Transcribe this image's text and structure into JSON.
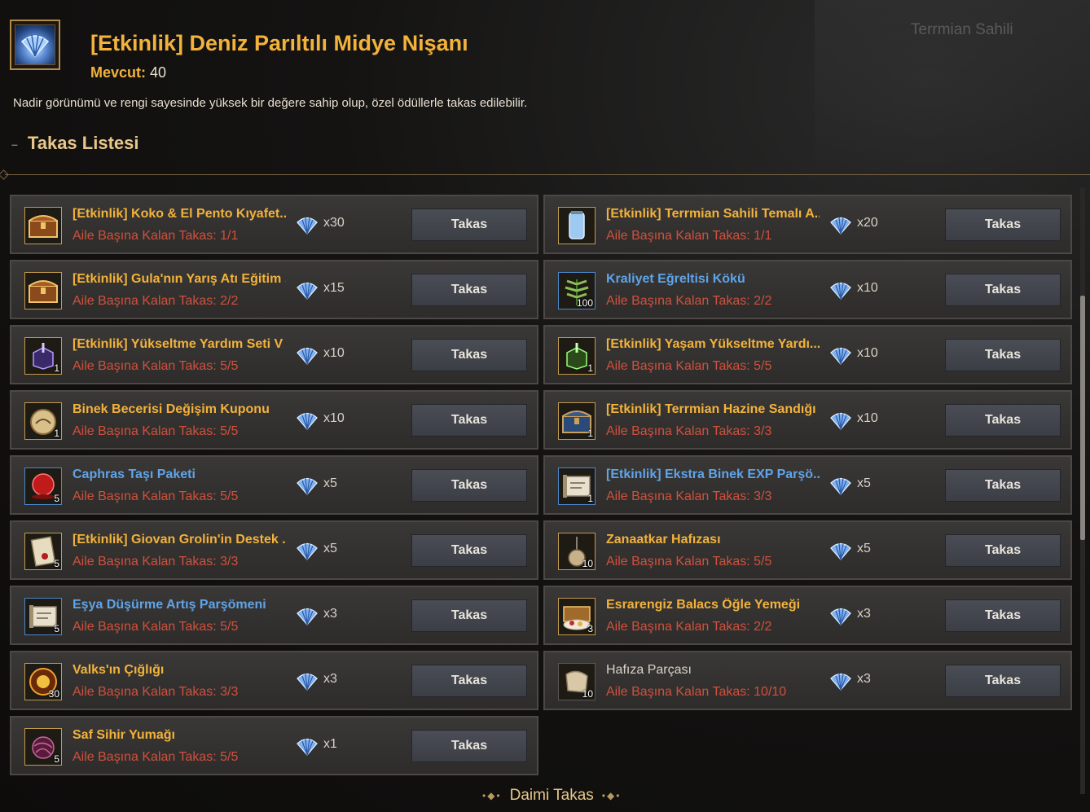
{
  "map": {
    "label": "Terrmian Sahili"
  },
  "header": {
    "title": "[Etkinlik] Deniz Parıltılı Midye Nişanı",
    "mevcut_label": "Mevcut:",
    "mevcut_value": "40",
    "description": "Nadir görünümü ve rengi sayesinde yüksek bir değere sahip olup, özel ödüllerle takas edilebilir."
  },
  "section": {
    "title": "Takas Listesi"
  },
  "colors": {
    "accent": "#f2b23b",
    "remaining": "#d0503c",
    "rare_blue": "#5fa4e8"
  },
  "exchange_button_label": "Takas",
  "items": [
    {
      "name": "[Etkinlik] Koko & El Pento Kıyafet...",
      "name_color": "yellow",
      "icon": "chest-icon",
      "qty": "",
      "remaining_label": "Aile Başına Kalan Takas:",
      "remaining": "1/1",
      "cost": "x30"
    },
    {
      "name": "[Etkinlik] Terrmian Sahili Temalı A...",
      "name_color": "yellow",
      "icon": "jar-icon",
      "qty": "",
      "remaining_label": "Aile Başına Kalan Takas:",
      "remaining": "1/1",
      "cost": "x20"
    },
    {
      "name": "[Etkinlik] Gula'nın Yarış Atı Eğitim ...",
      "name_color": "yellow",
      "icon": "chest-icon",
      "qty": "",
      "remaining_label": "Aile Başına Kalan Takas:",
      "remaining": "2/2",
      "cost": "x15"
    },
    {
      "name": "Kraliyet Eğreltisi Kökü",
      "name_color": "blue",
      "icon": "fern-icon",
      "qty": "100",
      "remaining_label": "Aile Başına Kalan Takas:",
      "remaining": "2/2",
      "cost": "x10"
    },
    {
      "name": "[Etkinlik] Yükseltme Yardım Seti V",
      "name_color": "yellow",
      "icon": "purple-box-icon",
      "qty": "1",
      "remaining_label": "Aile Başına Kalan Takas:",
      "remaining": "5/5",
      "cost": "x10"
    },
    {
      "name": "[Etkinlik] Yaşam Yükseltme Yardı...",
      "name_color": "yellow",
      "icon": "green-box-icon",
      "qty": "1",
      "remaining_label": "Aile Başına Kalan Takas:",
      "remaining": "5/5",
      "cost": "x10"
    },
    {
      "name": "Binek Becerisi Değişim Kuponu",
      "name_color": "yellow",
      "icon": "coupon-icon",
      "qty": "1",
      "remaining_label": "Aile Başına Kalan Takas:",
      "remaining": "5/5",
      "cost": "x10"
    },
    {
      "name": "[Etkinlik] Terrmian Hazine Sandığı",
      "name_color": "yellow",
      "icon": "treasure-chest-icon",
      "qty": "1",
      "remaining_label": "Aile Başına Kalan Takas:",
      "remaining": "3/3",
      "cost": "x10"
    },
    {
      "name": "Caphras Taşı Paketi",
      "name_color": "blue",
      "icon": "red-stone-icon",
      "qty": "5",
      "remaining_label": "Aile Başına Kalan Takas:",
      "remaining": "5/5",
      "cost": "x5"
    },
    {
      "name": "[Etkinlik] Ekstra Binek EXP Parşö...",
      "name_color": "blue",
      "icon": "scroll-icon",
      "qty": "1",
      "remaining_label": "Aile Başına Kalan Takas:",
      "remaining": "3/3",
      "cost": "x5"
    },
    {
      "name": "[Etkinlik] Giovan Grolin'in Destek ...",
      "name_color": "yellow",
      "icon": "letter-icon",
      "qty": "5",
      "remaining_label": "Aile Başına Kalan Takas:",
      "remaining": "3/3",
      "cost": "x5"
    },
    {
      "name": "Zanaatkar Hafızası",
      "name_color": "yellow",
      "icon": "memory-icon",
      "qty": "10",
      "remaining_label": "Aile Başına Kalan Takas:",
      "remaining": "5/5",
      "cost": "x5"
    },
    {
      "name": "Eşya Düşürme Artış Parşömeni",
      "name_color": "blue",
      "icon": "scroll-icon",
      "qty": "5",
      "remaining_label": "Aile Başına Kalan Takas:",
      "remaining": "5/5",
      "cost": "x3"
    },
    {
      "name": "Esrarengiz Balacs Öğle Yemeği",
      "name_color": "yellow",
      "icon": "food-icon",
      "qty": "3",
      "remaining_label": "Aile Başına Kalan Takas:",
      "remaining": "2/2",
      "cost": "x3"
    },
    {
      "name": "Valks'ın Çığlığı",
      "name_color": "yellow",
      "icon": "orb-icon",
      "qty": "30",
      "remaining_label": "Aile Başına Kalan Takas:",
      "remaining": "3/3",
      "cost": "x3"
    },
    {
      "name": "Hafıza Parçası",
      "name_color": "white",
      "icon": "fragment-icon",
      "qty": "10",
      "remaining_label": "Aile Başına Kalan Takas:",
      "remaining": "10/10",
      "cost": "x3"
    },
    {
      "name": "Saf Sihir Yumağı",
      "name_color": "yellow",
      "icon": "yarn-icon",
      "qty": "5",
      "remaining_label": "Aile Başına Kalan Takas:",
      "remaining": "5/5",
      "cost": "x1"
    }
  ],
  "footer": {
    "label": "Daimi Takas"
  }
}
